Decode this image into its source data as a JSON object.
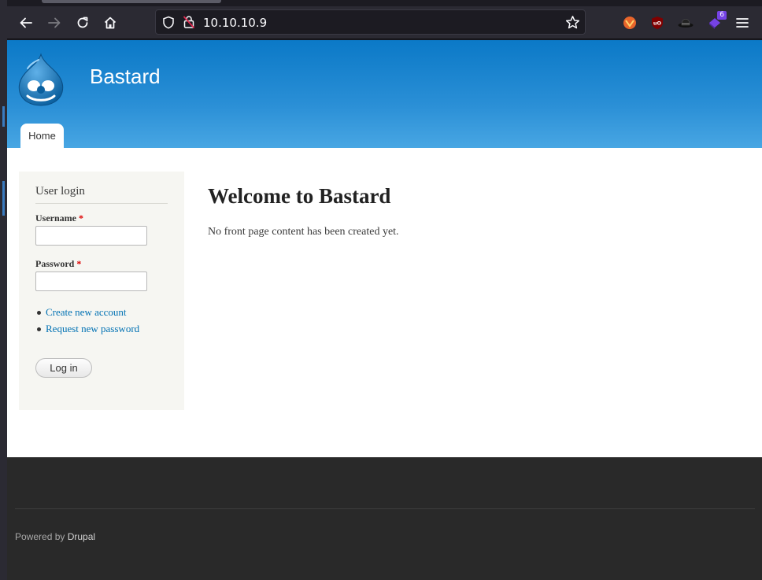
{
  "browser": {
    "url": "10.10.10.9",
    "icons": {
      "back": "back-arrow-icon",
      "forward": "forward-arrow-icon",
      "reload": "reload-icon",
      "home": "home-icon",
      "shield": "shield-icon",
      "lock": "insecure-lock-icon",
      "bookmark": "star-icon",
      "menu": "hamburger-menu-icon"
    },
    "extensions": [
      {
        "name": "foxyproxy-icon",
        "badge": ""
      },
      {
        "name": "ublock-icon",
        "badge": ""
      },
      {
        "name": "hat-icon",
        "badge": ""
      },
      {
        "name": "extension-puzzle-icon",
        "badge": "6"
      }
    ]
  },
  "site": {
    "name": "Bastard",
    "logo": "drupal-drop-logo",
    "nav": {
      "home": "Home"
    },
    "colors": {
      "header": "#1a85d0",
      "link": "#0071b3",
      "footer": "#292929"
    }
  },
  "login": {
    "title": "User login",
    "username_label": "Username",
    "password_label": "Password",
    "required_mark": "*",
    "username_value": "",
    "password_value": "",
    "links": {
      "create": "Create new account",
      "request": "Request new password"
    },
    "submit": "Log in"
  },
  "main": {
    "title": "Welcome to Bastard",
    "text": "No front page content has been created yet."
  },
  "footer": {
    "powered_prefix": "Powered by",
    "powered_link": "Drupal"
  }
}
